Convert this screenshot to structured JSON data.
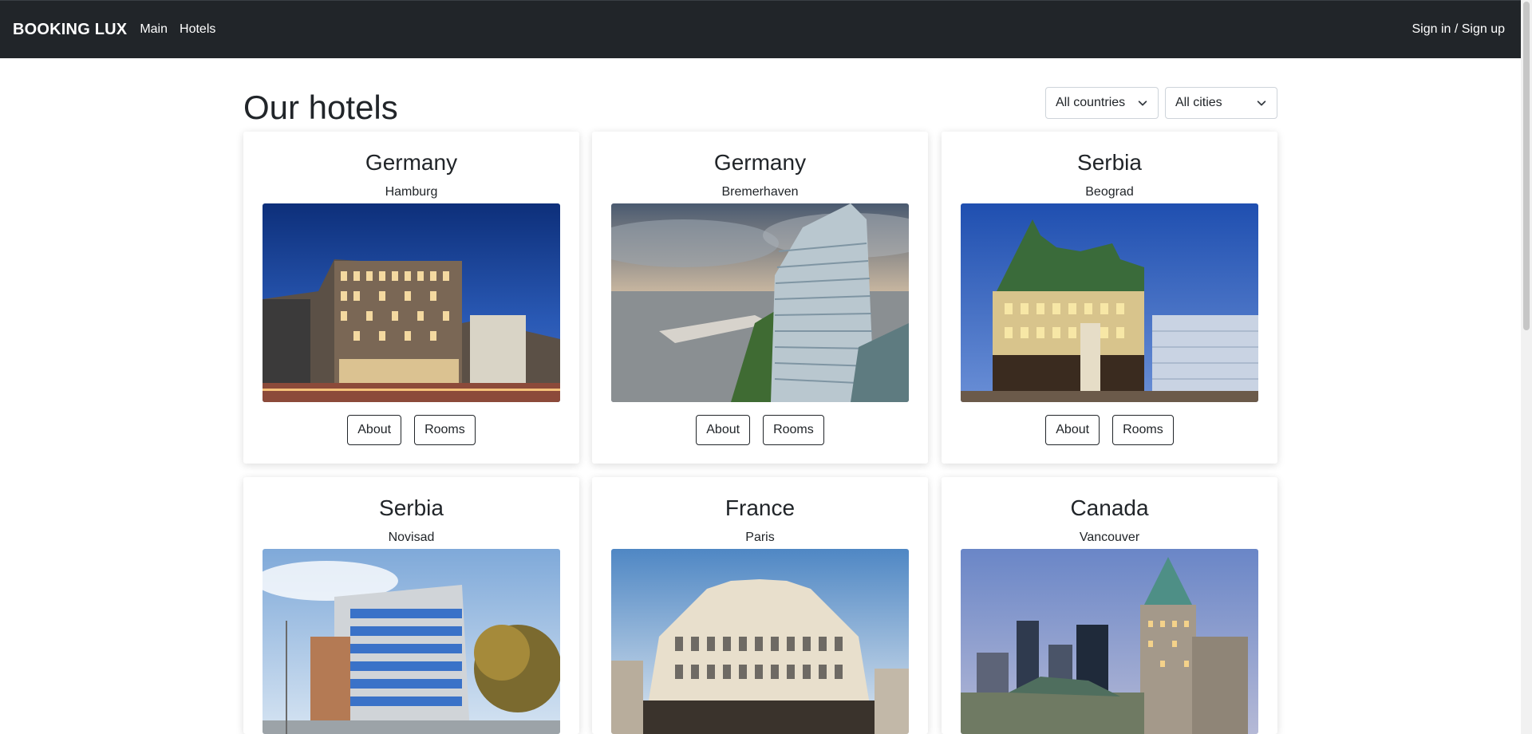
{
  "navbar": {
    "brand": "BOOKING LUX",
    "links": [
      "Main",
      "Hotels"
    ],
    "auth": "Sign in / Sign up"
  },
  "header": {
    "title": "Our hotels",
    "country_filter": "All countries",
    "city_filter": "All cities"
  },
  "hotels": [
    {
      "country": "Germany",
      "city": "Hamburg",
      "image": "hamburg-hotel-photo",
      "about": "About",
      "rooms": "Rooms"
    },
    {
      "country": "Germany",
      "city": "Bremerhaven",
      "image": "bremerhaven-hotel-photo",
      "about": "About",
      "rooms": "Rooms"
    },
    {
      "country": "Serbia",
      "city": "Beograd",
      "image": "beograd-hotel-photo",
      "about": "About",
      "rooms": "Rooms"
    },
    {
      "country": "Serbia",
      "city": "Novisad",
      "image": "novisad-hotel-photo"
    },
    {
      "country": "France",
      "city": "Paris",
      "image": "paris-hotel-photo"
    },
    {
      "country": "Canada",
      "city": "Vancouver",
      "image": "vancouver-hotel-photo"
    }
  ],
  "icons": {
    "dropdown": "chevron-down-icon"
  },
  "colors": {
    "navbar": "#212529",
    "text": "#212529",
    "card_shadow": "rgba(0,0,0,0.14)"
  }
}
